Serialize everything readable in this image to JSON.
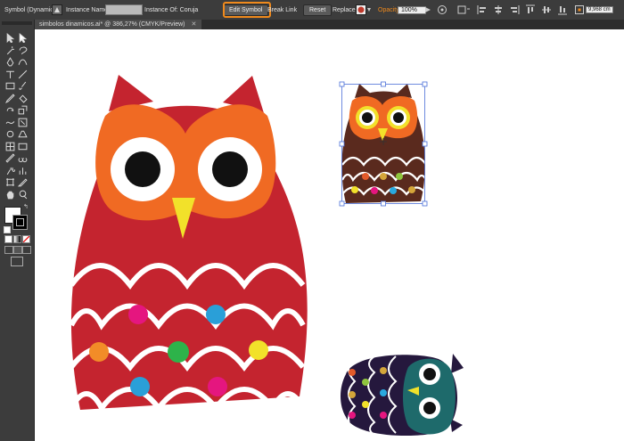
{
  "control_bar": {
    "mode_label": "Symbol (Dynamic)",
    "instance_name_label": "Instance Name:",
    "instance_name_value": "",
    "instance_of_label": "Instance Of: Coruja",
    "edit_symbol_label": "Edit Symbol",
    "break_link_label": "Break Link",
    "reset_label": "Reset",
    "replace_label": "Replace:",
    "opacity_label": "Opacity:",
    "opacity_value": "100%",
    "width_value": "9,968 cm",
    "accent_color": "#f08a1c"
  },
  "document": {
    "tab_title": "simbolos dinamicos.ai* @ 386,27% (CMYK/Preview)",
    "close_icon": "close-icon"
  },
  "tools": {
    "icons": [
      "selection-tool-icon",
      "direct-selection-tool-icon",
      "magic-wand-icon",
      "lasso-icon",
      "pen-tool-icon",
      "curvature-icon",
      "type-tool-icon",
      "line-tool-icon",
      "rectangle-tool-icon",
      "paintbrush-icon",
      "pencil-icon",
      "eraser-icon",
      "rotate-tool-icon",
      "scale-tool-icon",
      "warp-tool-icon",
      "free-transform-icon",
      "shape-builder-icon",
      "perspective-icon",
      "mesh-tool-icon",
      "gradient-tool-icon",
      "eyedropper-icon",
      "blend-tool-icon",
      "symbol-sprayer-icon",
      "column-graph-icon",
      "artboard-tool-icon",
      "slice-tool-icon",
      "hand-tool-icon",
      "zoom-tool-icon"
    ]
  },
  "colors": {
    "fill": "#ffffff",
    "stroke": "#000000"
  }
}
